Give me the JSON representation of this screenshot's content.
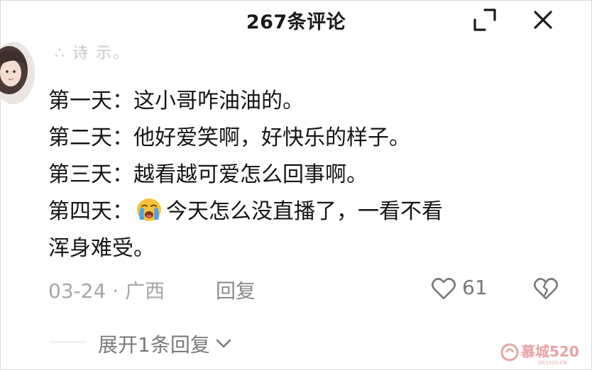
{
  "header": {
    "title": "267条评论",
    "expand_icon": "expand-icon",
    "close_icon": "close-icon"
  },
  "comment": {
    "username": "∴ 诗 示。",
    "lines": [
      "第一天：这小哥咋油油的。",
      "第二天：他好爱笑啊，好快乐的样子。",
      "第三天：越看越可爱怎么回事啊。"
    ],
    "line4_prefix": "第四天：",
    "line4_emoji": "loudly-crying-face",
    "line4_text": "今天怎么没直播了，一看不看",
    "line5": "浑身难受。",
    "date_location": "03-24 · 广西",
    "reply_label": "回复",
    "like_count": "61"
  },
  "footer": {
    "expand_replies": "展开1条回复"
  },
  "watermark": {
    "text": "慕城520",
    "subtext": "OCS520.CN"
  },
  "colors": {
    "text": "#151515",
    "meta": "#a6a6a6",
    "emoji_yellow": "#f7c23a",
    "tears": "#4aa3e8"
  }
}
